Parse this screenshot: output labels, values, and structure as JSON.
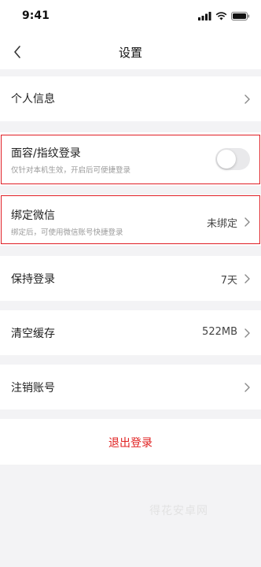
{
  "status_bar": {
    "time": "9:41",
    "icons": [
      "signal-icon",
      "wifi-icon",
      "battery-icon"
    ]
  },
  "nav": {
    "title": "设置",
    "back_icon": "chevron-left-icon"
  },
  "rows": {
    "personal_info": {
      "label": "个人信息"
    },
    "face_login": {
      "label": "面容/指纹登录",
      "subtitle": "仅针对本机生效，开启后可便捷登录",
      "toggle_on": false
    },
    "bind_wechat": {
      "label": "绑定微信",
      "subtitle": "绑定后，可使用微信账号快捷登录",
      "value": "未绑定"
    },
    "keep_login": {
      "label": "保持登录",
      "value": "7天"
    },
    "clear_cache": {
      "label": "清空缓存",
      "value": "522MB"
    },
    "cancel_account": {
      "label": "注销账号"
    }
  },
  "logout": {
    "label": "退出登录"
  },
  "watermark": "得花安卓网",
  "colors": {
    "highlight_border": "#e01e25",
    "logout_text": "#e02020",
    "page_background": "#f3f3f5"
  }
}
